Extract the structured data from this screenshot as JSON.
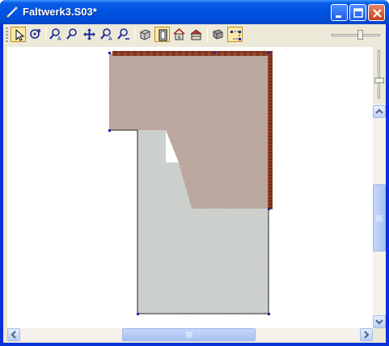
{
  "window": {
    "title": "Faltwerk3.S03*",
    "icons": {
      "app": "pen-tool-icon",
      "minimize": "minimize-icon",
      "maximize": "maximize-icon",
      "close": "close-icon"
    }
  },
  "toolbar": {
    "buttons": [
      {
        "name": "select-pointer",
        "icon": "arrow-pointer-icon",
        "active": true
      },
      {
        "name": "rotate-view",
        "icon": "rotate-view-icon",
        "active": false
      },
      {
        "name": "zoom-previous",
        "icon": "zoom-previous-icon",
        "active": false
      },
      {
        "name": "zoom-in",
        "icon": "zoom-in-icon",
        "active": false
      },
      {
        "name": "pan",
        "icon": "pan-arrows-icon",
        "active": false
      },
      {
        "name": "zoom-all",
        "icon": "zoom-all-icon",
        "active": false
      },
      {
        "name": "zoom-window",
        "icon": "zoom-window-icon",
        "active": false
      },
      {
        "name": "3d-view",
        "icon": "cube-3d-icon",
        "active": false
      },
      {
        "name": "plan-view",
        "icon": "plan-view-icon",
        "active": true
      },
      {
        "name": "house-view",
        "icon": "house-icon",
        "active": false
      },
      {
        "name": "section-view",
        "icon": "section-house-icon",
        "active": false
      },
      {
        "name": "render-mode",
        "icon": "render-box-icon",
        "active": false
      },
      {
        "name": "point-snap",
        "icon": "point-snap-icon",
        "active": true
      }
    ],
    "zoom_slider_level": 0.55
  },
  "scrollbars": {
    "vertical_level": 0.5,
    "horizontal_level": 0.5
  },
  "colors": {
    "title_bar": "#0054e3",
    "drawing_bg": "#ffffff",
    "brown_surface": "#b49a8f",
    "gray_surface": "#cfd3cf",
    "brick_edge": "#8a3a22",
    "vertex_marker": "#1a2aa8"
  }
}
